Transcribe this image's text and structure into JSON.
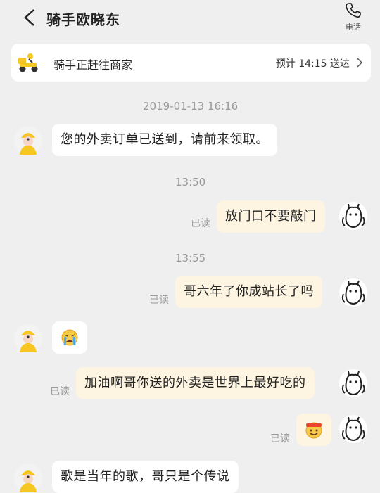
{
  "header": {
    "title": "骑手欧晓东",
    "phone_label": "电话"
  },
  "status": {
    "text": "骑手正赶往商家",
    "eta": "预计 14:15 送达"
  },
  "messages": [
    {
      "kind": "time",
      "text": "2019-01-13 16:16"
    },
    {
      "kind": "in",
      "text": "您的外卖订单已送到，请前来领取。"
    },
    {
      "kind": "time",
      "text": "13:50"
    },
    {
      "kind": "out",
      "text": "放门口不要敲门",
      "read": "已读"
    },
    {
      "kind": "time",
      "text": "13:55"
    },
    {
      "kind": "out",
      "text": "哥六年了你成站长了吗",
      "read": "已读"
    },
    {
      "kind": "in-emoji",
      "emoji": "crying-face"
    },
    {
      "kind": "out",
      "text": "加油啊哥你送的外卖是世界上最好吃的",
      "read": "已读"
    },
    {
      "kind": "out-emoji",
      "emoji": "cheering-face",
      "read": "已读"
    },
    {
      "kind": "in",
      "text": "歌是当年的歌，哥只是个传说"
    }
  ],
  "colors": {
    "background": "#efefef",
    "incoming_bubble": "#ffffff",
    "outgoing_bubble": "#fdf5e2",
    "rider_helmet": "#f6c623"
  }
}
